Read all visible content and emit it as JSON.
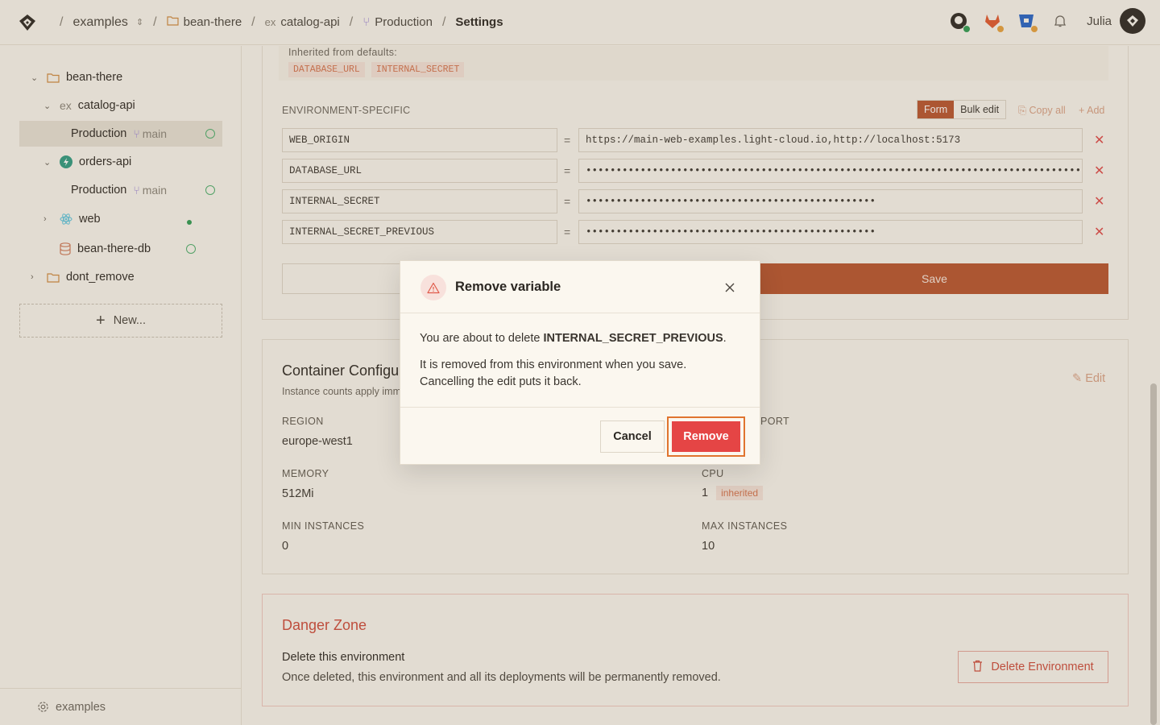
{
  "topbar": {
    "breadcrumbs": [
      {
        "label": "examples"
      },
      {
        "label": "bean-there"
      },
      {
        "prefix": "ex",
        "label": "catalog-api"
      },
      {
        "label": "Production"
      },
      {
        "label": "Settings"
      }
    ],
    "user_name": "Julia"
  },
  "sidebar": {
    "items": [
      {
        "label": "bean-there"
      },
      {
        "prefix": "ex",
        "label": "catalog-api"
      },
      {
        "label": "Production",
        "branch": "main"
      },
      {
        "label": "orders-api"
      },
      {
        "label": "Production",
        "branch": "main"
      },
      {
        "label": "web"
      },
      {
        "label": "bean-there-db"
      },
      {
        "label": "dont_remove"
      }
    ],
    "new_label": "New...",
    "footer_label": "examples"
  },
  "env_vars": {
    "inherited_label": "Inherited from defaults:",
    "inherited_chips": [
      "DATABASE_URL",
      "INTERNAL_SECRET"
    ],
    "section_label": "ENVIRONMENT-SPECIFIC",
    "toggle": {
      "form": "Form",
      "bulk": "Bulk edit"
    },
    "copy_all": "Copy all",
    "add": "Add",
    "rows": [
      {
        "key": "WEB_ORIGIN",
        "value": "https://main-web-examples.light-cloud.io,http://localhost:5173"
      },
      {
        "key": "DATABASE_URL",
        "value": "••••••••••••••••••••••••••••••••••••••••••••••••••••••••••••••••••••••••••••••••••••••"
      },
      {
        "key": "INTERNAL_SECRET",
        "value": "••••••••••••••••••••••••••••••••••••••••••••••••"
      },
      {
        "key": "INTERNAL_SECRET_PREVIOUS",
        "value": "••••••••••••••••••••••••••••••••••••••••••••••••"
      }
    ],
    "eq": "=",
    "save_label": "Save"
  },
  "container": {
    "title": "Container Configu",
    "subtitle": "Instance counts apply imm",
    "edit_label": "Edit",
    "region_label": "REGION",
    "region_value": "europe-west1",
    "port_label": "PORT",
    "memory_label": "MEMORY",
    "memory_value": "512Mi",
    "cpu_label": "CPU",
    "cpu_value": "1",
    "cpu_badge": "inherited",
    "min_label": "MIN INSTANCES",
    "min_value": "0",
    "max_label": "MAX INSTANCES",
    "max_value": "10"
  },
  "danger": {
    "title": "Danger Zone",
    "heading": "Delete this environment",
    "description": "Once deleted, this environment and all its deployments will be permanently removed.",
    "button": "Delete Environment"
  },
  "modal": {
    "title": "Remove variable",
    "line1_prefix": "You are about to delete ",
    "line1_var": "INTERNAL_SECRET_PREVIOUS",
    "line1_suffix": ".",
    "line2": "It is removed from this environment when you save.",
    "line3": "Cancelling the edit puts it back.",
    "cancel": "Cancel",
    "remove": "Remove"
  },
  "colors": {
    "accent": "#b9532c",
    "danger": "#e54545",
    "focus_ring": "#e0742f",
    "background": "#fbf7ef"
  }
}
